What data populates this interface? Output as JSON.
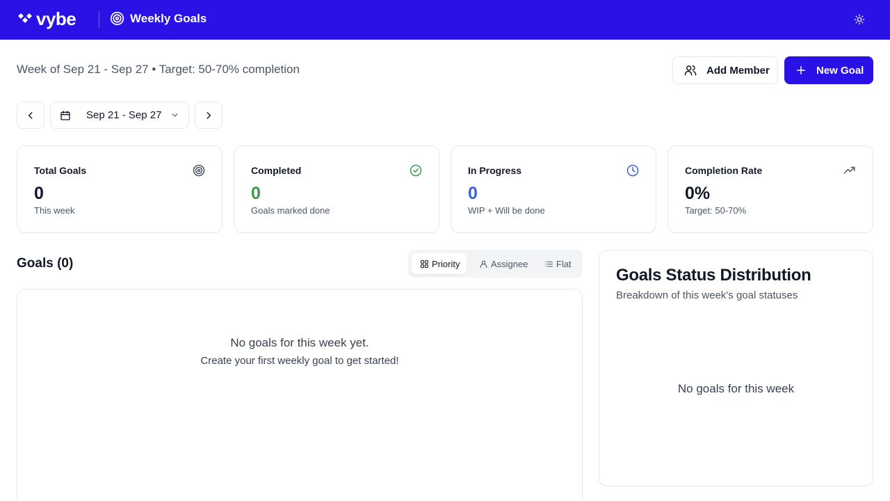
{
  "app": {
    "logo_text": "vybe",
    "page_title": "Weekly Goals",
    "brand_color": "#2a12e6"
  },
  "header": {
    "subtitle": "Week of Sep 21 - Sep 27 • Target: 50-70% completion",
    "add_member_label": "Add Member",
    "new_goal_label": "New Goal"
  },
  "week_nav": {
    "date_range": "Sep 21 - Sep 27"
  },
  "stats": [
    {
      "title": "Total Goals",
      "value": "0",
      "sub": "This week",
      "icon": "target-icon",
      "color": "#111827"
    },
    {
      "title": "Completed",
      "value": "0",
      "sub": "Goals marked done",
      "icon": "check-circle-icon",
      "color": "#3d9a4a"
    },
    {
      "title": "In Progress",
      "value": "0",
      "sub": "WIP + Will be done",
      "icon": "clock-icon",
      "color": "#3b63d6"
    },
    {
      "title": "Completion Rate",
      "value": "0%",
      "sub": "Target: 50-70%",
      "icon": "trending-up-icon",
      "color": "#111827"
    }
  ],
  "goals": {
    "heading": "Goals (0)",
    "views": [
      {
        "label": "Priority",
        "icon": "grid-icon",
        "active": true
      },
      {
        "label": "Assignee",
        "icon": "user-icon",
        "active": false
      },
      {
        "label": "Flat",
        "icon": "list-icon",
        "active": false
      }
    ],
    "empty_title": "No goals for this week yet.",
    "empty_sub": "Create your first weekly goal to get started!"
  },
  "distribution": {
    "title": "Goals Status Distribution",
    "subtitle": "Breakdown of this week's goal statuses",
    "empty": "No goals for this week"
  }
}
